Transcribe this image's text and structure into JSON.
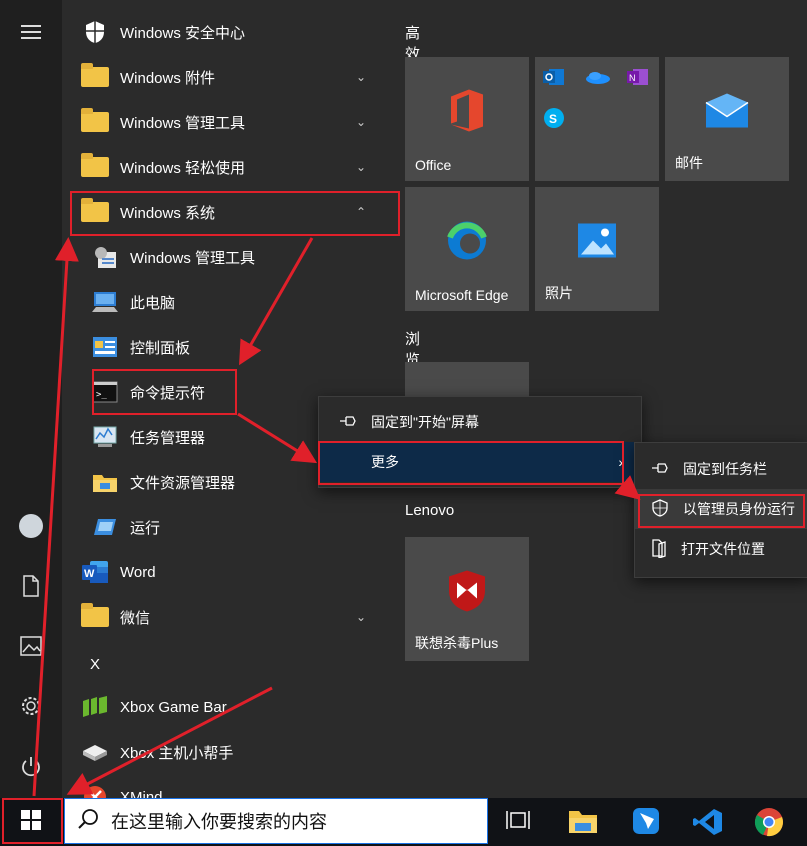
{
  "app_list": {
    "items": [
      {
        "label": "Windows 安全中心",
        "icon": "shield-icon"
      },
      {
        "label": "Windows 附件",
        "icon": "folder-icon"
      },
      {
        "label": "Windows 管理工具",
        "icon": "folder-icon"
      },
      {
        "label": "Windows 轻松使用",
        "icon": "folder-icon"
      },
      {
        "label": "Windows 系统",
        "icon": "folder-icon"
      },
      {
        "label": "Windows 管理工具",
        "icon": "admin-tools-icon"
      },
      {
        "label": "此电脑",
        "icon": "computer-icon"
      },
      {
        "label": "控制面板",
        "icon": "control-panel-icon"
      },
      {
        "label": "命令提示符",
        "icon": "cmd-icon"
      },
      {
        "label": "任务管理器",
        "icon": "task-manager-icon"
      },
      {
        "label": "文件资源管理器",
        "icon": "file-explorer-icon"
      },
      {
        "label": "运行",
        "icon": "run-icon"
      },
      {
        "label": "Word",
        "icon": "word-icon"
      },
      {
        "label": "微信",
        "icon": "folder-icon"
      },
      {
        "label": "X",
        "icon": ""
      },
      {
        "label": "Xbox Game Bar",
        "icon": "xbox-game-bar-icon"
      },
      {
        "label": "Xbox 主机小帮手",
        "icon": "xbox-companion-icon"
      },
      {
        "label": "XMind",
        "icon": "xmind-icon"
      }
    ]
  },
  "tiles": {
    "groups": [
      "高效工作",
      "浏览",
      "Lenovo"
    ],
    "office": "Office",
    "mail": "邮件",
    "edge": "Microsoft Edge",
    "photos": "照片",
    "mcafee": "联想杀毒Plus"
  },
  "context_menu": {
    "pin_start": "固定到\"开始\"屏幕",
    "more": "更多"
  },
  "sub_menu": {
    "pin_taskbar": "固定到任务栏",
    "run_as_admin": "以管理员身份运行",
    "open_location": "打开文件位置"
  },
  "taskbar": {
    "search_placeholder": "在这里输入你要搜索的内容"
  },
  "colors": {
    "accent_red": "#e0202a",
    "search_border": "#1a73e8",
    "menu_highlight": "#0d2a48"
  }
}
